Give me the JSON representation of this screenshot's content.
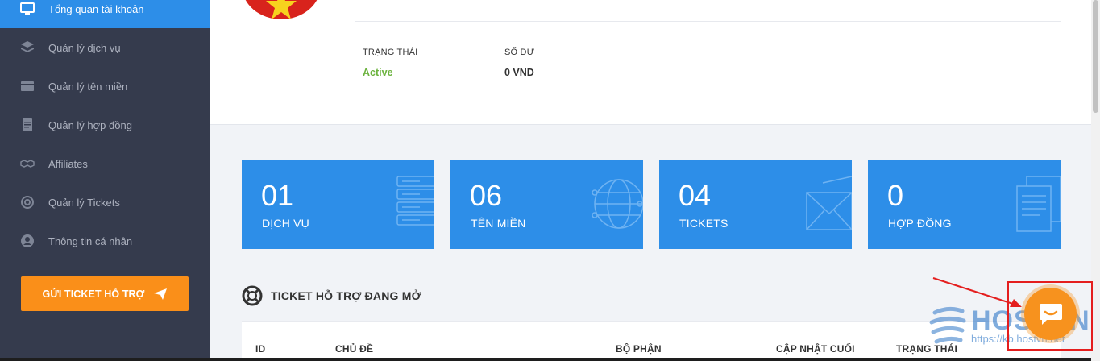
{
  "sidebar": {
    "items": [
      {
        "label": "Tổng quan tài khoản",
        "icon": "monitor-icon",
        "active": true
      },
      {
        "label": "Quản lý dịch vụ",
        "icon": "layers-icon",
        "active": false
      },
      {
        "label": "Quản lý tên miền",
        "icon": "card-icon",
        "active": false
      },
      {
        "label": "Quản lý hợp đồng",
        "icon": "document-icon",
        "active": false
      },
      {
        "label": "Affiliates",
        "icon": "handshake-icon",
        "active": false
      },
      {
        "label": "Quản lý Tickets",
        "icon": "lifebuoy-icon",
        "active": false
      },
      {
        "label": "Thông tin cá nhân",
        "icon": "user-icon",
        "active": false
      }
    ],
    "support_button": "GỬI TICKET HỖ TRỢ"
  },
  "account": {
    "status_label": "TRẠNG THÁI",
    "status_value": "Active",
    "balance_label": "SỐ DƯ",
    "balance_value": "0 VND"
  },
  "tiles": [
    {
      "count": "01",
      "label": "DỊCH VỤ",
      "icon": "server-icon"
    },
    {
      "count": "06",
      "label": "TÊN MIỀN",
      "icon": "globe-icon"
    },
    {
      "count": "04",
      "label": "TICKETS",
      "icon": "envelope-icon"
    },
    {
      "count": "0",
      "label": "HỢP ĐỒNG",
      "icon": "documents-icon"
    }
  ],
  "tickets": {
    "title": "TICKET HỖ TRỢ ĐANG MỞ",
    "columns": [
      "ID",
      "CHỦ ĐỀ",
      "BỘ PHẬN",
      "CẬP NHẬT CUỐI",
      "TRẠNG THÁI"
    ]
  },
  "watermark": {
    "brand": "HOSTVN",
    "url": "https://kb.hostvn.net"
  },
  "colors": {
    "sidebar_bg": "#353b4d",
    "accent_blue": "#2d8ee8",
    "accent_orange": "#fa8f19",
    "status_green": "#6cb33f",
    "annotation_red": "#e41e1e"
  }
}
